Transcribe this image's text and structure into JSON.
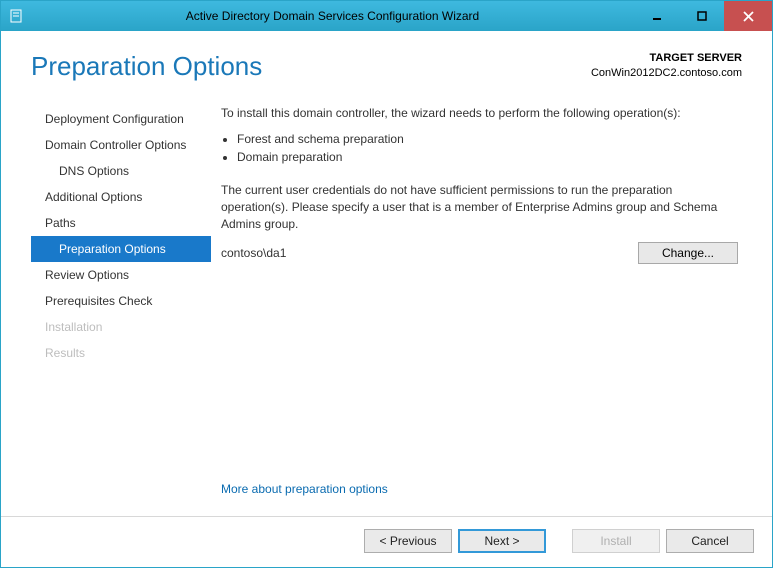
{
  "window": {
    "title": "Active Directory Domain Services Configuration Wizard"
  },
  "header": {
    "heading": "Preparation Options",
    "target_label": "TARGET SERVER",
    "target_value": "ConWin2012DC2.contoso.com"
  },
  "nav": {
    "items": [
      {
        "label": "Deployment Configuration",
        "level": 0,
        "state": "normal"
      },
      {
        "label": "Domain Controller Options",
        "level": 0,
        "state": "normal"
      },
      {
        "label": "DNS Options",
        "level": 1,
        "state": "normal"
      },
      {
        "label": "Additional Options",
        "level": 0,
        "state": "normal"
      },
      {
        "label": "Paths",
        "level": 0,
        "state": "normal"
      },
      {
        "label": "Preparation Options",
        "level": 1,
        "state": "selected"
      },
      {
        "label": "Review Options",
        "level": 0,
        "state": "normal"
      },
      {
        "label": "Prerequisites Check",
        "level": 0,
        "state": "normal"
      },
      {
        "label": "Installation",
        "level": 0,
        "state": "disabled"
      },
      {
        "label": "Results",
        "level": 0,
        "state": "disabled"
      }
    ]
  },
  "main": {
    "intro": "To install this domain controller, the wizard needs to perform the following operation(s):",
    "bullets": [
      "Forest and schema preparation",
      "Domain preparation"
    ],
    "cred_note": "The current user credentials do not have sufficient permissions to run the preparation operation(s). Please specify a user that is a member of Enterprise Admins group and Schema Admins group.",
    "cred_user": "contoso\\da1",
    "change_label": "Change...",
    "more_link": "More about preparation options"
  },
  "footer": {
    "previous": "< Previous",
    "next": "Next >",
    "install": "Install",
    "cancel": "Cancel"
  }
}
